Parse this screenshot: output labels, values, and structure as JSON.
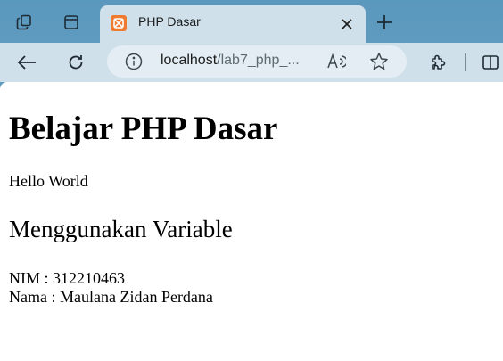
{
  "browser": {
    "tab": {
      "title": "PHP Dasar"
    },
    "address": {
      "host": "localhost",
      "path": "/lab7_php_..."
    },
    "icons": {
      "workspaces": "workspaces-icon",
      "tab_actions": "tab-actions-icon",
      "favicon": "xampp-favicon-icon",
      "close": "close-icon",
      "new_tab": "plus-icon",
      "back": "back-arrow-icon",
      "refresh": "refresh-icon",
      "info": "info-icon",
      "read_aloud": "read-aloud-icon",
      "favorite": "star-icon",
      "extensions": "extensions-icon",
      "split_screen": "split-screen-icon"
    },
    "colors": {
      "frame": "#5f9bbf",
      "toolbar": "#cfe0ea",
      "favicon": "#f07a2f"
    }
  },
  "page": {
    "heading": "Belajar PHP Dasar",
    "greeting": "Hello World",
    "subheading": "Menggunakan Variable",
    "nim": "NIM : 312210463",
    "nama": "Nama : Maulana Zidan Perdana"
  }
}
